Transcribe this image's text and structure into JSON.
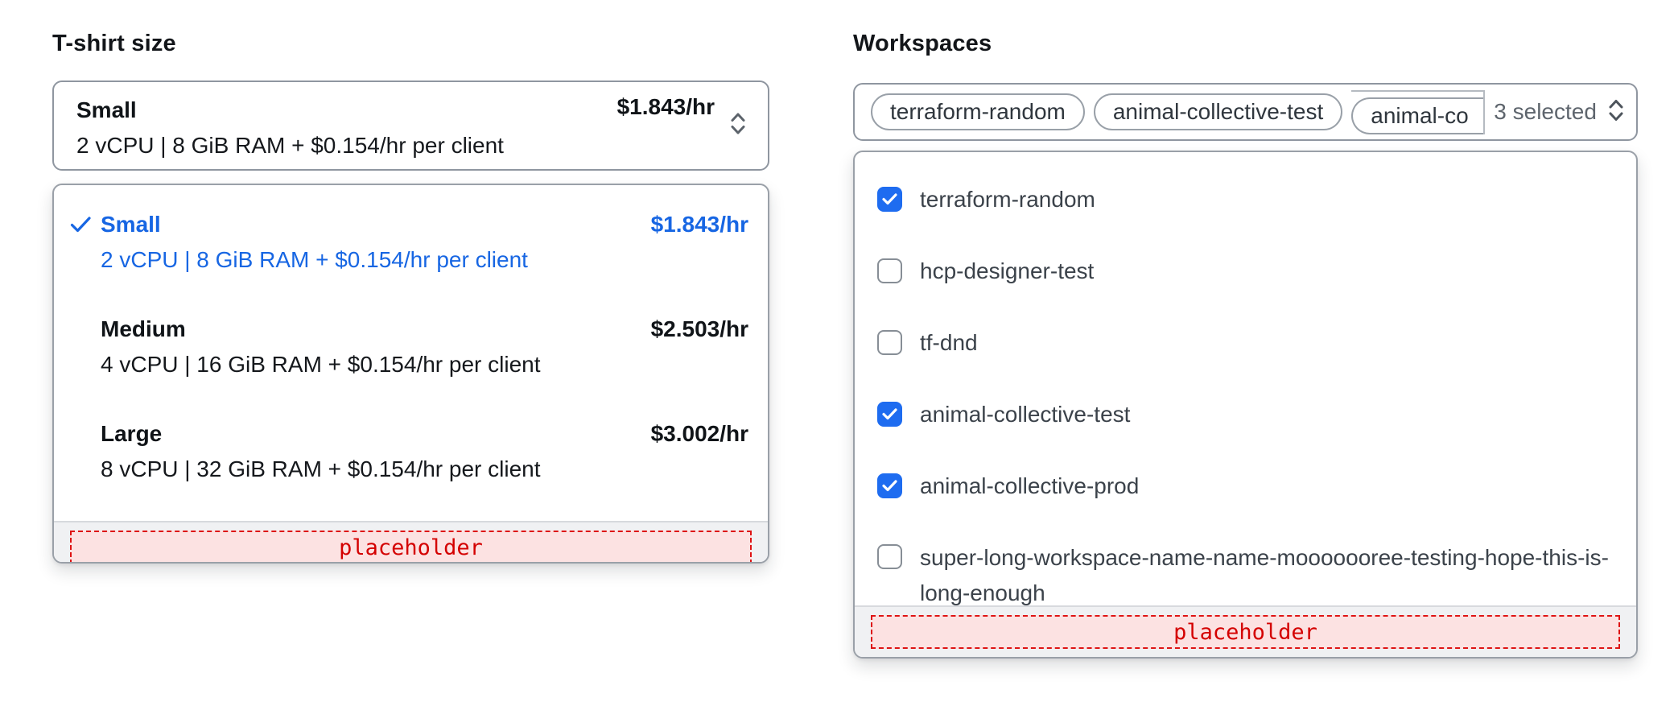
{
  "tshirt": {
    "label": "T-shirt size",
    "trigger": {
      "name": "Small",
      "description": "2 vCPU | 8 GiB RAM + $0.154/hr per client",
      "price": "$1.843/hr"
    },
    "options": [
      {
        "name": "Small",
        "description": "2 vCPU | 8 GiB RAM + $0.154/hr per client",
        "price": "$1.843/hr",
        "selected": true
      },
      {
        "name": "Medium",
        "description": "4 vCPU | 16 GiB RAM + $0.154/hr per client",
        "price": "$2.503/hr",
        "selected": false
      },
      {
        "name": "Large",
        "description": "8 vCPU | 32 GiB RAM + $0.154/hr per client",
        "price": "$3.002/hr",
        "selected": false
      }
    ],
    "placeholder": "placeholder"
  },
  "workspaces": {
    "label": "Workspaces",
    "trigger": {
      "pills": [
        "terraform-random",
        "animal-collective-test"
      ],
      "clipped_pill": "animal-co",
      "summary": "3 selected"
    },
    "options": [
      {
        "label": "terraform-random",
        "checked": true
      },
      {
        "label": "hcp-designer-test",
        "checked": false
      },
      {
        "label": "tf-dnd",
        "checked": false
      },
      {
        "label": "animal-collective-test",
        "checked": true
      },
      {
        "label": "animal-collective-prod",
        "checked": true
      },
      {
        "label": "super-long-workspace-name-name-mooooooree-testing-hope-this-is-long-enough",
        "checked": false
      }
    ],
    "placeholder": "placeholder"
  },
  "colors": {
    "selected_option_blue": "#1766e3",
    "checkbox_blue": "#1e6cf0",
    "placeholder_red": "#d40000",
    "footer_gray": "#f0f1f3"
  }
}
